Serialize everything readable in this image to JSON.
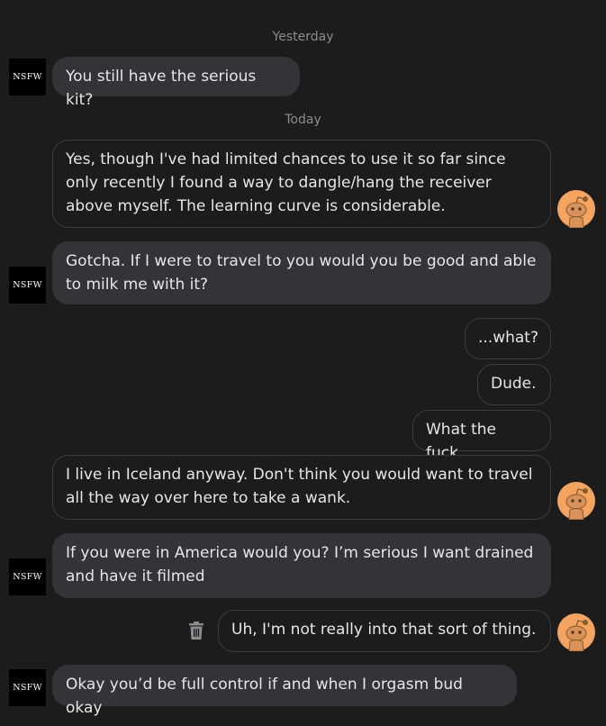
{
  "dividers": {
    "yesterday": "Yesterday",
    "today": "Today"
  },
  "nsfw_label": "NSFW",
  "messages": [
    {
      "side": "in",
      "text": "You still have the serious kit?"
    },
    {
      "side": "out",
      "text": "Yes, though I've had limited chances to use it so far since\nonly recently I found a way to dangle/hang the receiver\nabove myself. The learning curve is considerable."
    },
    {
      "side": "in",
      "text": "Gotcha. If I were to travel to you would you be good and able\nto milk me with it?"
    },
    {
      "side": "out",
      "text": "...what?"
    },
    {
      "side": "out",
      "text": "Dude."
    },
    {
      "side": "out",
      "text": "What the fuck."
    },
    {
      "side": "out",
      "text": "I live in Iceland anyway. Don't think you would want to travel\nall the way over here to take a wank."
    },
    {
      "side": "in",
      "text": "If you were in America would you? I’m serious I want drained\nand have it filmed"
    },
    {
      "side": "out",
      "text": "Uh, I'm not really into that sort of thing."
    },
    {
      "side": "in",
      "text": "Okay you’d be full control if and when I orgasm bud okay"
    }
  ],
  "icons": {
    "self_avatar": "snoo-avatar-icon",
    "delete": "trash-icon"
  },
  "colors": {
    "background": "#1c1c1d",
    "incoming_bubble": "#333437",
    "outgoing_border": "#3b3c3f",
    "avatar_bg": "#f4a460"
  }
}
